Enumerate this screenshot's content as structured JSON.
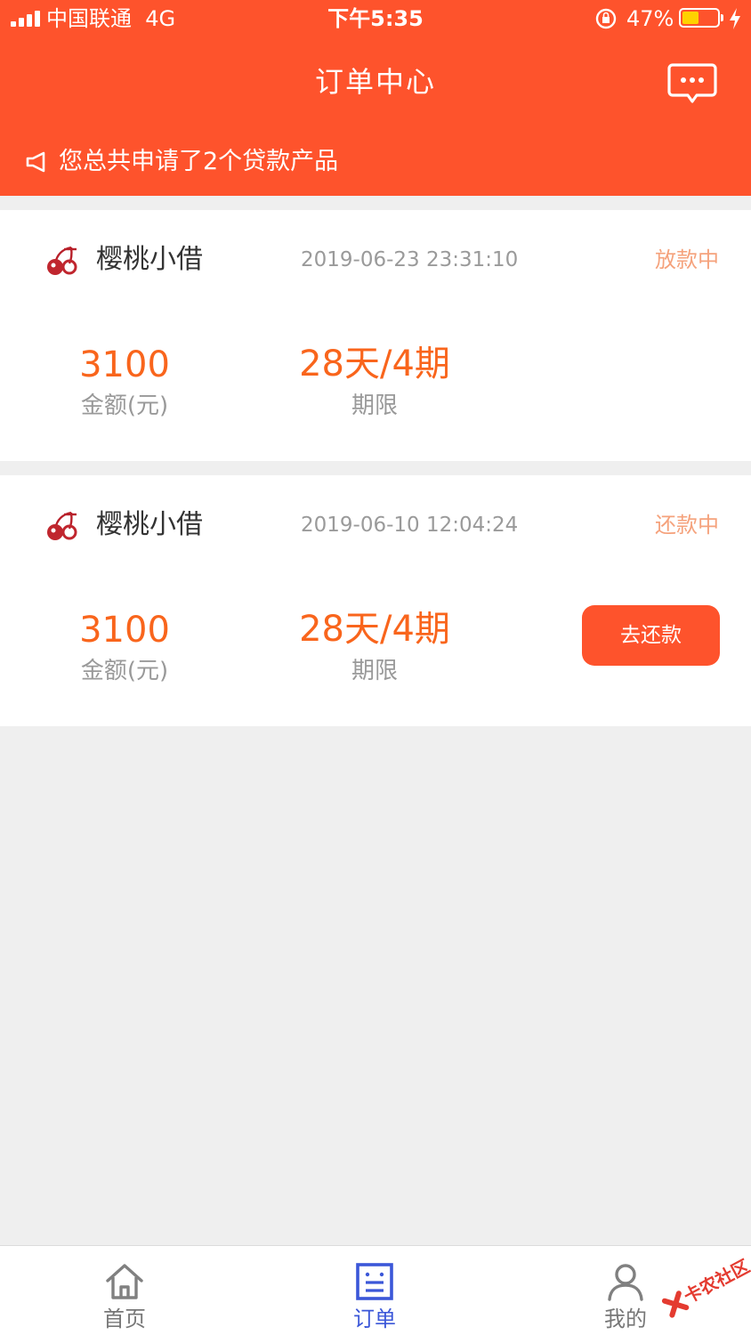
{
  "status_bar": {
    "carrier": "中国联通",
    "network": "4G",
    "time": "下午5:35",
    "battery": "47%",
    "battery_level": 0.47
  },
  "header": {
    "title": "订单中心",
    "notice": "您总共申请了2个贷款产品"
  },
  "orders": [
    {
      "product": "樱桃小借",
      "date": "2019-06-23 23:31:10",
      "status": "放款中",
      "amount": "3100",
      "amount_label": "金额(元)",
      "term": "28天/4期",
      "term_label": "期限"
    },
    {
      "product": "樱桃小借",
      "date": "2019-06-10 12:04:24",
      "status": "还款中",
      "amount": "3100",
      "amount_label": "金额(元)",
      "term": "28天/4期",
      "term_label": "期限",
      "action": "去还款"
    }
  ],
  "tabbar": {
    "items": [
      {
        "label": "首页",
        "icon": "home-icon"
      },
      {
        "label": "订单",
        "icon": "orders-icon",
        "active": true
      },
      {
        "label": "我的",
        "icon": "profile-icon"
      }
    ]
  },
  "watermark": {
    "text": "卡农社区"
  },
  "colors": {
    "brand": "#fe532c",
    "amount": "#f9651c",
    "status": "#f5a27c",
    "active_tab": "#3b57d8"
  }
}
